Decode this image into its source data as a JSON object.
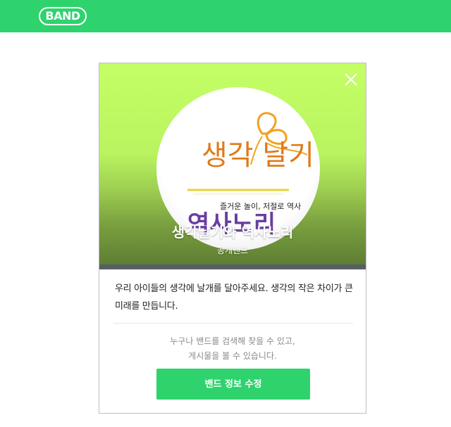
{
  "colors": {
    "brand": "#2ed36e",
    "cover_top": "#c4ff66",
    "cover_bottom": "#5e7e33"
  },
  "header": {
    "logo_text": "BAND"
  },
  "band": {
    "name": "생각날기와 역사노리",
    "type": "공개밴드",
    "emblem": {
      "title": "생각 날기",
      "tagline": "즐거운 놀이, 저절로 역사",
      "sub_title": "역사노리"
    },
    "description": "우리 아이들의 생각에 날개를 달아주세요. 생각의 작은 차이가 큰 미래를 만듭니다.",
    "notice_line1": "누구나 밴드를 검색해 찾을 수 있고,",
    "notice_line2": "게시물을 볼 수 있습니다.",
    "edit_button_label": "밴드 정보 수정"
  },
  "icons": {
    "close": "close-icon"
  }
}
